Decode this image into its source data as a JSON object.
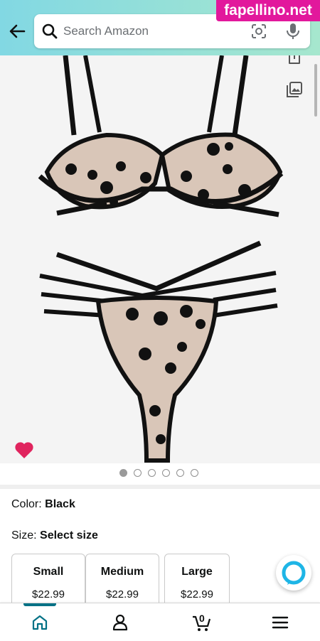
{
  "header": {
    "search_placeholder": "Search Amazon"
  },
  "watermark": "fapellino.net",
  "icons": {
    "back": "arrow-left-icon",
    "search": "search-icon",
    "lens": "camera-lens-icon",
    "mic": "microphone-icon",
    "share": "share-icon",
    "gallery": "gallery-icon",
    "favorite": "heart-icon",
    "alexa": "alexa-icon"
  },
  "carousel": {
    "count": 6,
    "active_index": 0
  },
  "product": {
    "color_label": "Color:",
    "color_value": "Black",
    "size_label": "Size:",
    "size_value": "Select size",
    "sizes": [
      {
        "name": "Small",
        "price": "$22.99"
      },
      {
        "name": "Medium",
        "price": "$22.99"
      },
      {
        "name": "Large",
        "price": "$22.99"
      }
    ]
  },
  "bottom_nav": {
    "items": [
      "home-icon",
      "account-icon",
      "cart-icon",
      "menu-icon"
    ],
    "cart_count": "0"
  },
  "colors": {
    "header_gradient_start": "#82d8e3",
    "header_gradient_end": "#a6e7ce",
    "accent": "#007185",
    "heart": "#e0245e",
    "watermark_bg": "#e2189c"
  }
}
